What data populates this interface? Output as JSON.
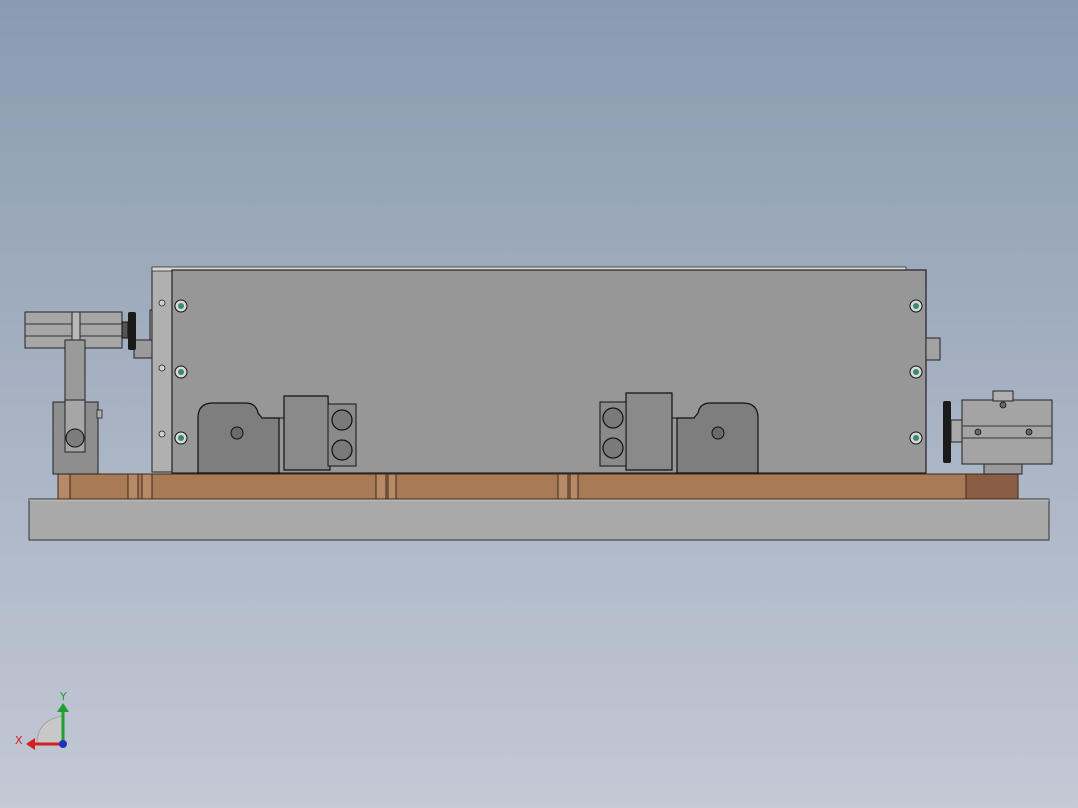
{
  "viewport": {
    "background_top": "#8a9bb0",
    "background_bottom": "#c3c9d5"
  },
  "model": {
    "base_color": "#a8a8a8",
    "copper_color": "#a87a56",
    "housing_color": "#979797",
    "clamp_color": "#7e7e7e",
    "screw_color": "#3a8a6a"
  },
  "triad": {
    "x_label": "X",
    "y_label": "Y",
    "x_color": "#d42020",
    "y_color": "#20a030",
    "z_color": "#2030c0"
  }
}
